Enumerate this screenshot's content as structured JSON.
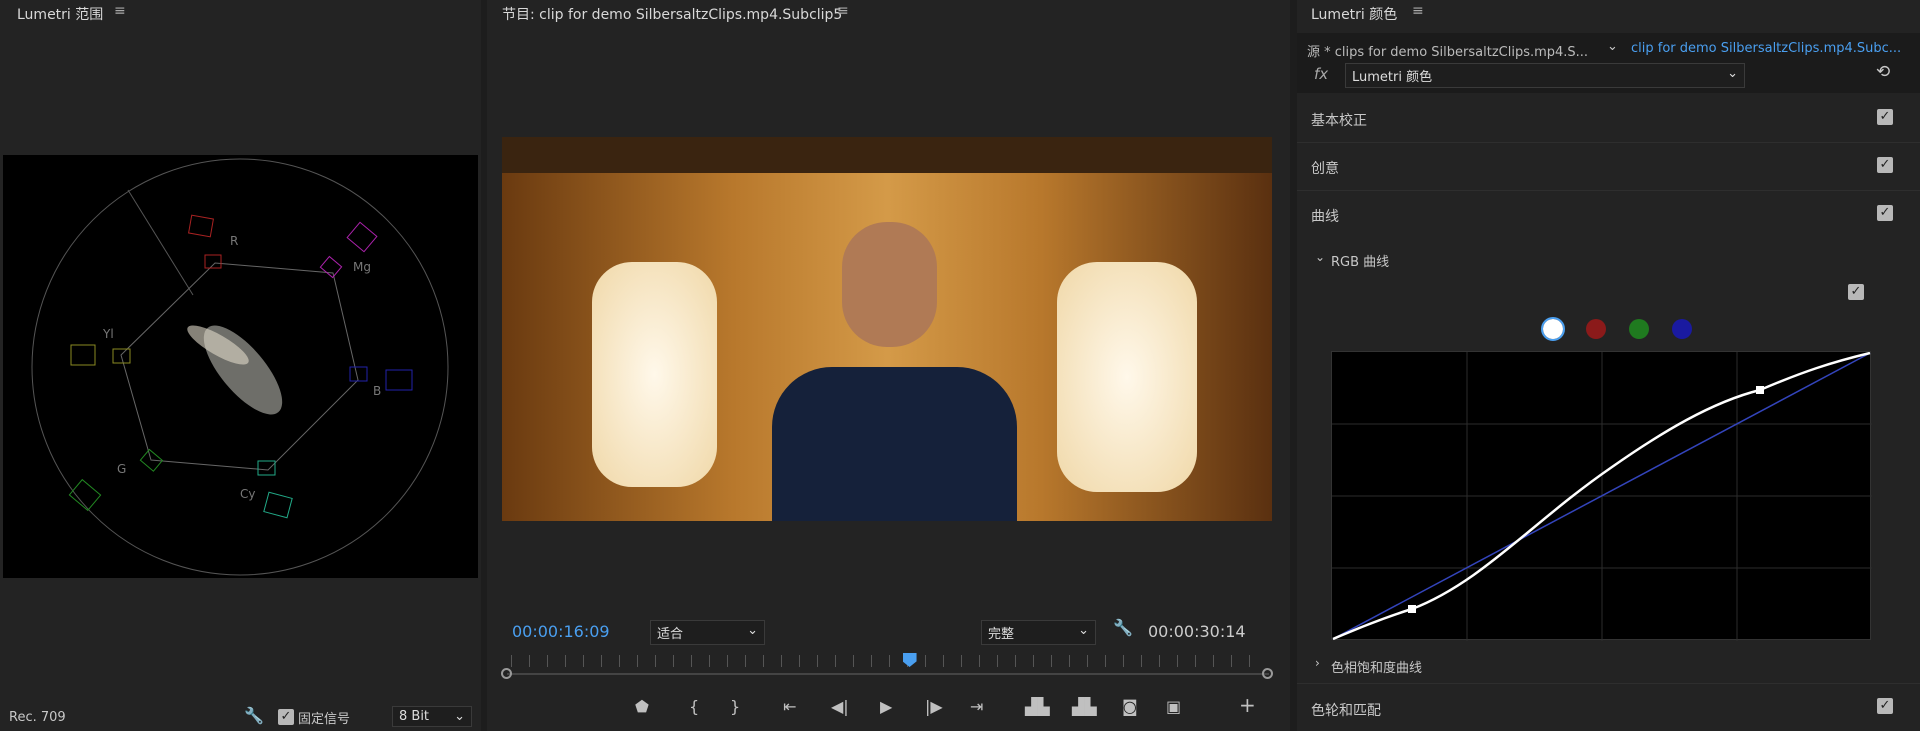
{
  "scopes": {
    "title": "Lumetri 范围",
    "labels": {
      "r": "R",
      "mg": "Mg",
      "yl": "Yl",
      "b": "B",
      "g": "G",
      "cy": "Cy"
    },
    "standard": "Rec. 709",
    "clamp_label": "固定信号",
    "clamp_checked": true,
    "bit_depth": "8 Bit"
  },
  "program": {
    "title": "节目: clip for demo SilbersaltzClips.mp4.Subclip5",
    "current_time": "00:00:16:09",
    "fit": "适合",
    "quality": "完整",
    "duration": "00:00:30:14",
    "playhead_fraction": 0.53
  },
  "lumetri": {
    "title": "Lumetri 颜色",
    "source_tab": "源 * clips for demo SilbersaltzClips.mp4.S...",
    "clip_tab": "clip for demo SilbersaltzClips.mp4.Subc...",
    "effect": "Lumetri 颜色",
    "fx": "fx",
    "sections": [
      {
        "label": "基本校正",
        "checked": true
      },
      {
        "label": "创意",
        "checked": true
      },
      {
        "label": "曲线",
        "checked": true
      }
    ],
    "rgb_curves": "RGB 曲线",
    "hue_sat": "色相饱和度曲线",
    "wheels": "色轮和匹配",
    "channel_colors": [
      "#ffffff",
      "#8b1a1a",
      "#1f7a1f",
      "#1a1aa0"
    ]
  }
}
